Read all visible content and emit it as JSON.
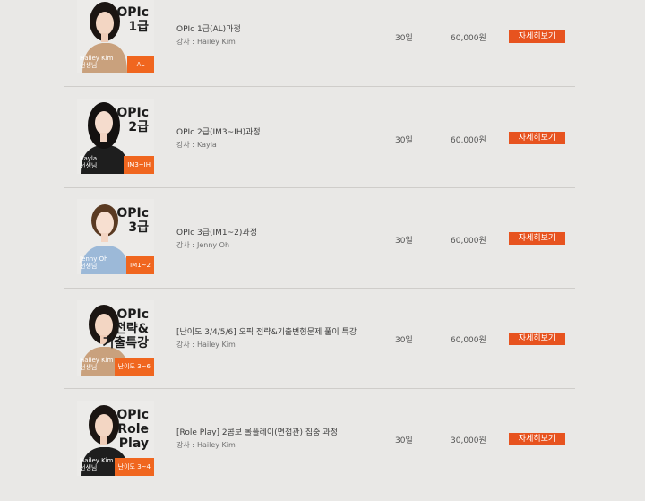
{
  "courses": [
    {
      "thumb_title_lines": [
        "OPIc",
        "1급"
      ],
      "thumb_teacher_lines": [
        "Hailey Kim",
        "선생님"
      ],
      "thumb_badge": "AL",
      "name": "OPIc 1급(AL)과정",
      "instructor_label": "강사 :",
      "instructor": "Hailey Kim",
      "period": "30일",
      "price": "60,000원",
      "detail_label": "자세히보기"
    },
    {
      "thumb_title_lines": [
        "OPIc",
        "2급"
      ],
      "thumb_teacher_lines": [
        "Kayla",
        "선생님"
      ],
      "thumb_badge": "IM3~IH",
      "name": "OPIc 2급(IM3~IH)과정",
      "instructor_label": "강사 :",
      "instructor": "Kayla",
      "period": "30일",
      "price": "60,000원",
      "detail_label": "자세히보기"
    },
    {
      "thumb_title_lines": [
        "OPIc",
        "3급"
      ],
      "thumb_teacher_lines": [
        "Jenny Oh",
        "선생님"
      ],
      "thumb_badge": "IM1~2",
      "name": "OPIc 3급(IM1~2)과정",
      "instructor_label": "강사 :",
      "instructor": "Jenny Oh",
      "period": "30일",
      "price": "60,000원",
      "detail_label": "자세히보기"
    },
    {
      "thumb_title_lines": [
        "OPIc",
        "전략&",
        "기출특강"
      ],
      "thumb_teacher_lines": [
        "Hailey Kim",
        "선생님"
      ],
      "thumb_badge": "난이도 3~6",
      "name": "[난이도 3/4/5/6] 오픽 전략&기출변형문제 풀이 특강",
      "instructor_label": "강사 :",
      "instructor": "Hailey Kim",
      "period": "30일",
      "price": "60,000원",
      "detail_label": "자세히보기"
    },
    {
      "thumb_title_lines": [
        "OPIc",
        "Role",
        "Play"
      ],
      "thumb_teacher_lines": [
        "Hailey Kim",
        "선생님"
      ],
      "thumb_badge": "난이도 3~4",
      "name": "[Role Play] 2콤보 롤플레이(면접관) 집중 과정",
      "instructor_label": "강사 :",
      "instructor": "Hailey Kim",
      "period": "30일",
      "price": "30,000원",
      "detail_label": "자세히보기"
    }
  ],
  "colors": {
    "background": "#e9e8e6",
    "accent": "#e7531f",
    "badge": "#f0661f",
    "divider": "#cfcdca"
  },
  "icons": {
    "thumbnail_person": "instructor-portrait-icon"
  }
}
